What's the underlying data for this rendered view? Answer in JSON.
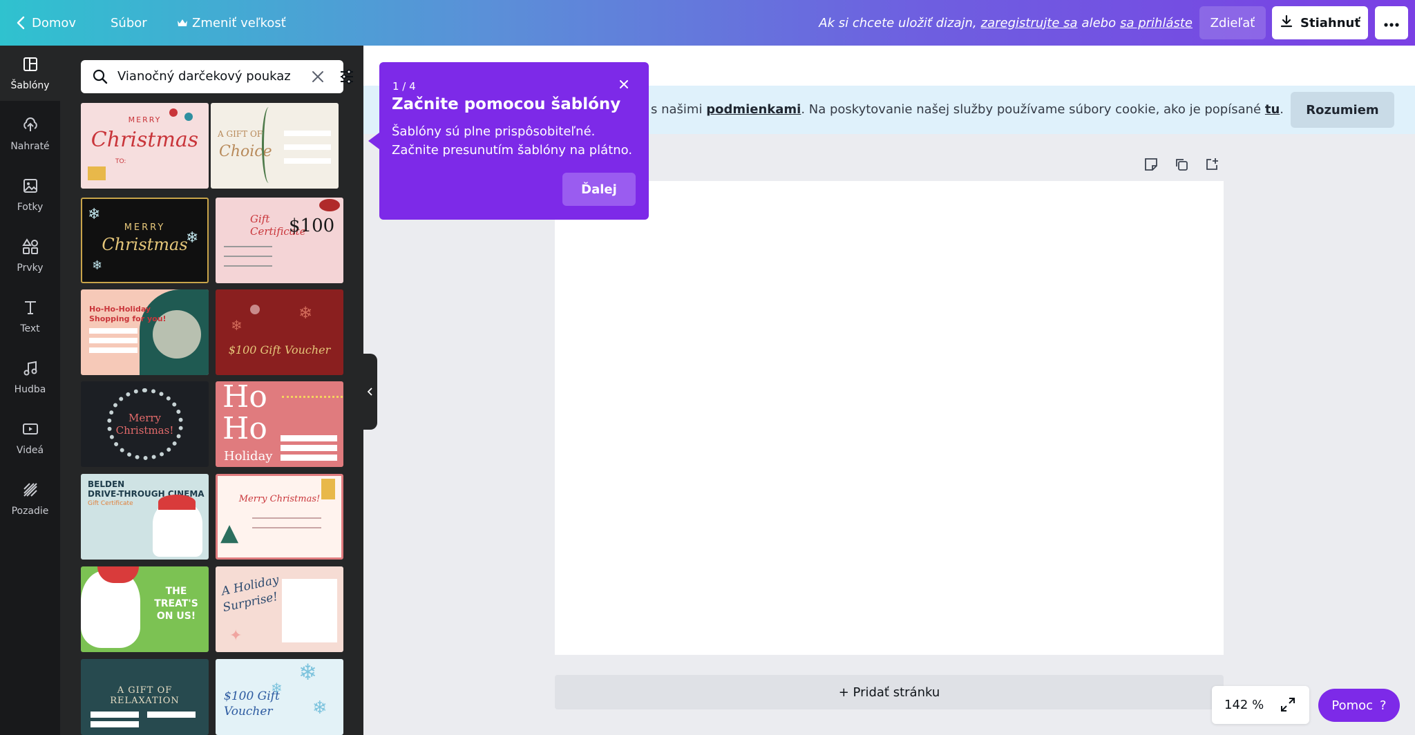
{
  "topbar": {
    "home_label": "Domov",
    "file_label": "Súbor",
    "resize_label": "Zmeniť veľkosť",
    "prompt_prefix": "Ak si chcete uložiť dizajn,",
    "prompt_register": "zaregistrujte sa",
    "prompt_or": "alebo",
    "prompt_login": "sa prihláste",
    "share_label": "Zdieľať",
    "download_label": "Stiahnuť",
    "more_icon": "more-icon"
  },
  "sidebar": {
    "items": [
      {
        "label": "Šablóny",
        "icon": "templates-icon"
      },
      {
        "label": "Nahraté",
        "icon": "upload-icon"
      },
      {
        "label": "Fotky",
        "icon": "photos-icon"
      },
      {
        "label": "Prvky",
        "icon": "elements-icon"
      },
      {
        "label": "Text",
        "icon": "text-icon"
      },
      {
        "label": "Hudba",
        "icon": "music-icon"
      },
      {
        "label": "Videá",
        "icon": "video-icon"
      },
      {
        "label": "Pozadie",
        "icon": "background-icon"
      }
    ]
  },
  "search": {
    "value": "Vianočný darčekový poukaz"
  },
  "templates": [
    {
      "l1": "MERRY",
      "l2": "Christmas",
      "l3": "TO:",
      "bg": "#f6dede",
      "fg": "#c9353a"
    },
    {
      "l1": "A GIFT OF",
      "l2": "Choice",
      "l3": "",
      "bg": "#f3efe6",
      "fg": "#b88a5a"
    },
    {
      "l1": "MERRY",
      "l2": "Christmas",
      "l3": "",
      "bg": "#101010",
      "fg": "#e6c77a"
    },
    {
      "l1": "Gift Certificate",
      "l2": "$100",
      "l3": "",
      "bg": "#f4d4d6",
      "fg": "#c9353a"
    },
    {
      "l1": "Ho-Ho-Holiday",
      "l2": "Shopping for you!",
      "l3": "",
      "bg": "#f6c9b8",
      "fg": "#c9353a"
    },
    {
      "l1": "$100 Gift Voucher",
      "l2": "",
      "l3": "",
      "bg": "#8a1f1f",
      "fg": "#e6c77a"
    },
    {
      "l1": "Merry",
      "l2": "Christmas!",
      "l3": "",
      "bg": "#1c1f24",
      "fg": "#e46b6b"
    },
    {
      "l1": "Ho",
      "l2": "Ho",
      "l3": "Holiday",
      "bg": "#e07b7e",
      "fg": "#ffffff"
    },
    {
      "l1": "BELDEN",
      "l2": "DRIVE-THROUGH CINEMA",
      "l3": "Gift Certificate",
      "bg": "#cfe3e4",
      "fg": "#1d3b4a"
    },
    {
      "l1": "Merry Christmas!",
      "l2": "",
      "l3": "",
      "bg": "#fff3ee",
      "fg": "#c9353a"
    },
    {
      "l1": "THE",
      "l2": "TREAT'S",
      "l3": "ON US!",
      "bg": "#7cc253",
      "fg": "#ffffff"
    },
    {
      "l1": "A Holiday",
      "l2": "Surprise!",
      "l3": "",
      "bg": "#f6dcd4",
      "fg": "#2c4a6e"
    },
    {
      "l1": "A GIFT OF RELAXATION",
      "l2": "",
      "l3": "",
      "bg": "#274a4f",
      "fg": "#e6ddc4"
    },
    {
      "l1": "$100 Gift",
      "l2": "Voucher",
      "l3": "",
      "bg": "#e3f2f7",
      "fg": "#2c5aa0"
    }
  ],
  "tooltip": {
    "step": "1 / 4",
    "title": "Začnite pomocou šablóny",
    "body": "Šablóny sú plne prispôsobiteľné. Začnite presunutím šablóny na plátno.",
    "next_label": "Ďalej"
  },
  "cookie": {
    "text_prefix": "s našimi",
    "terms_link": "podmienkami",
    "text_middle": ". Na poskytovanie našej služby používame súbory cookie, ako je popísané",
    "here_link": "tu",
    "text_suffix": ".",
    "button_label": "Rozumiem"
  },
  "canvas": {
    "add_page_label": "+ Pridať stránku"
  },
  "zoom": {
    "value": "142 %"
  },
  "help": {
    "label": "Pomoc",
    "icon_text": "?"
  },
  "colors": {
    "accent": "#7d2ae8",
    "rail_bg": "#18191b",
    "panel_bg": "#252627"
  }
}
